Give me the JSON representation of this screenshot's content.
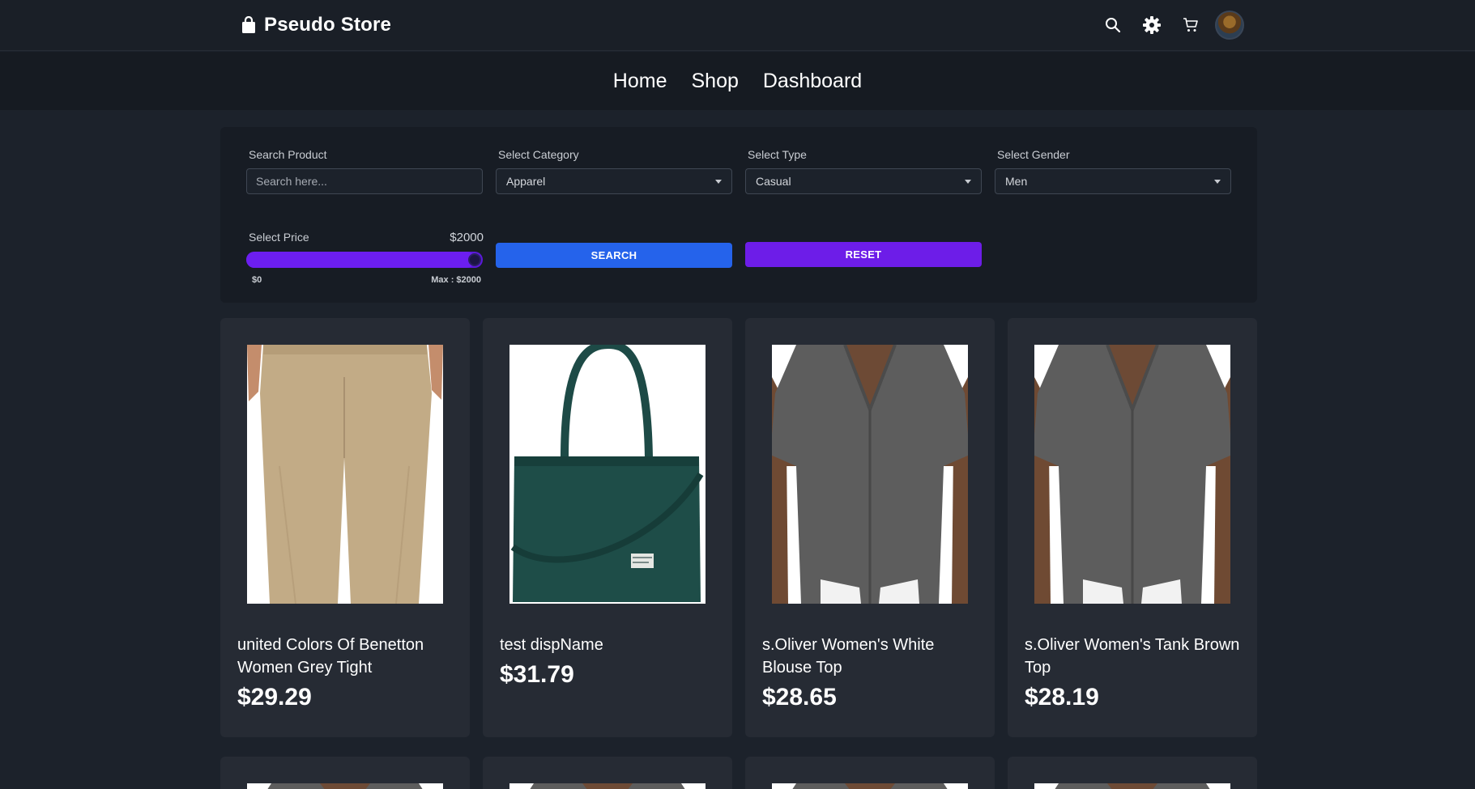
{
  "brand": {
    "name": "Pseudo Store"
  },
  "header_icons": [
    "search-icon",
    "gear-icon",
    "cart-icon",
    "avatar"
  ],
  "nav": {
    "links": [
      "Home",
      "Shop",
      "Dashboard"
    ]
  },
  "filters": {
    "search_label": "Search Product",
    "search_placeholder": "Search here...",
    "search_value": "",
    "category_label": "Select Category",
    "category_value": "Apparel",
    "type_label": "Select Type",
    "type_value": "Casual",
    "gender_label": "Select Gender",
    "gender_value": "Men",
    "price_label": "Select Price",
    "price_value": "$2000",
    "price_min_label": "$0",
    "price_max_label": "Max : $2000",
    "price_min": 0,
    "price_max": 2000,
    "price_current": 2000,
    "search_button": "SEARCH",
    "reset_button": "RESET"
  },
  "products": [
    {
      "name": "united Colors Of Benetton Women Grey Tight",
      "price": "$29.29",
      "image": "khaki-trousers"
    },
    {
      "name": "test dispName",
      "price": "$31.79",
      "image": "green-tote-bag"
    },
    {
      "name": "s.Oliver Women's White Blouse Top",
      "price": "$28.65",
      "image": "grey-shirt"
    },
    {
      "name": "s.Oliver Women's Tank Brown Top",
      "price": "$28.19",
      "image": "grey-shirt"
    }
  ],
  "colors": {
    "background": "#1c222b",
    "card": "#262b34",
    "search_button": "#2563eb",
    "reset_button": "#6d1de8",
    "slider": "#6c1ef0"
  }
}
